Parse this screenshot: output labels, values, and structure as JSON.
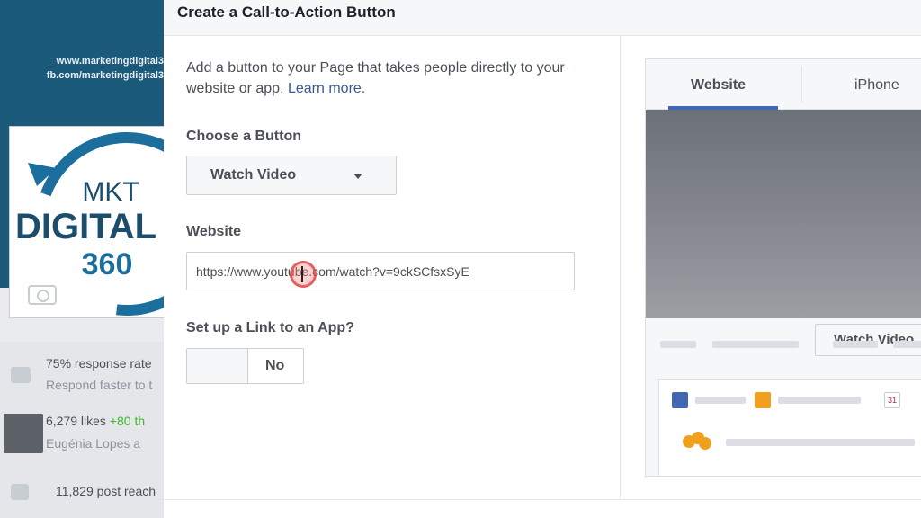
{
  "background_page": {
    "cover_urls": [
      "www.marketingdigital3",
      "fb.com/marketingdigital3"
    ],
    "logo": {
      "line1": "MKT",
      "line2": "DIGITAL",
      "line3": "360"
    },
    "stats": {
      "response_rate": "75% response rate",
      "respond_hint": "Respond faster to t",
      "likes": "6,279 likes",
      "likes_delta": "+80 th",
      "liker": "Eugénia Lopes a",
      "post_reach": "11,829 post reach"
    }
  },
  "dialog": {
    "title": "Create a Call-to-Action Button",
    "intro_text": "Add a button to your Page that takes people directly to your website or app.",
    "learn_more": "Learn more.",
    "choose_label": "Choose a Button",
    "selected_button": "Watch Video",
    "website_label": "Website",
    "website_value": "https://www.youtube.com/watch?v=9ckSCfsxSyE",
    "app_link_label": "Set up a Link to an App?",
    "app_link_toggle": "No"
  },
  "preview": {
    "tabs": [
      "Website",
      "iPhone"
    ],
    "active_tab": "Website",
    "cta_label": "Watch Video",
    "calendar_day": "31"
  },
  "colors": {
    "facebook_blue": "#4267b2",
    "link": "#365899",
    "cover_bg": "#1c5a7c"
  }
}
